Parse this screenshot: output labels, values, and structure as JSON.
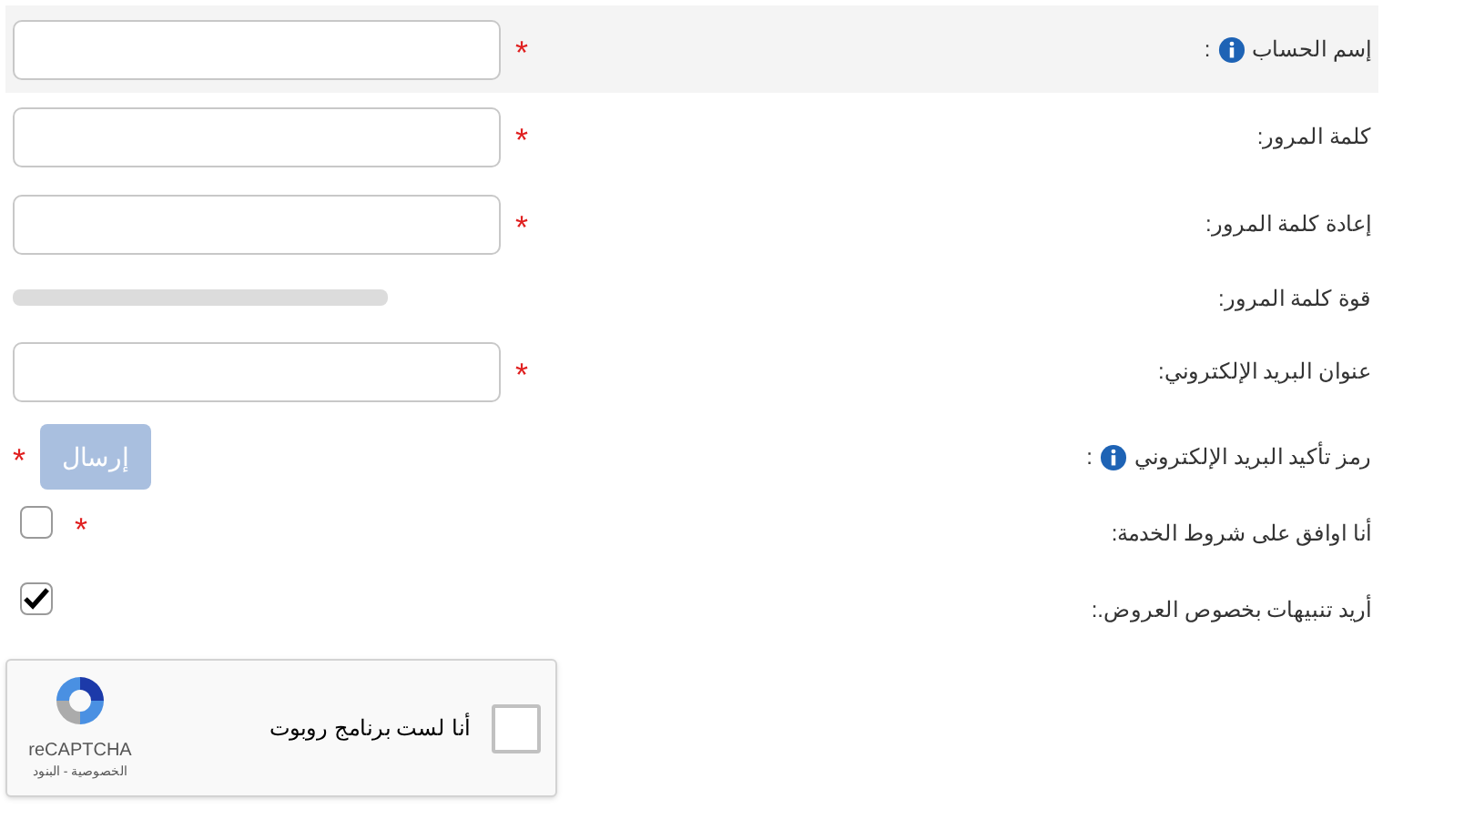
{
  "rows": [
    {
      "kind": "input",
      "label": "إسم الحساب",
      "info": true,
      "label_end": ":",
      "required": "*",
      "highlighted": true
    },
    {
      "kind": "input",
      "label": "كلمة المرور:",
      "required": "*"
    },
    {
      "kind": "input",
      "label": "إعادة كلمة المرور:",
      "required": "*"
    },
    {
      "kind": "meter",
      "label": "قوة كلمة المرور:",
      "level": 0
    },
    {
      "kind": "input",
      "label": "عنوان البريد الإلكتروني:",
      "required": "*"
    },
    {
      "kind": "button",
      "label": "رمز تأكيد البريد الإلكتروني",
      "info": true,
      "label_end": ":",
      "button": "إرسال",
      "disabled": true,
      "required": "*"
    },
    {
      "kind": "checkbox",
      "label": "أنا اوافق على شروط الخدمة:",
      "checked": false,
      "required": "*"
    },
    {
      "kind": "checkbox",
      "label": "أريد تنبيهات بخصوص العروض.:",
      "checked": true
    }
  ],
  "captcha": {
    "label": "أنا لست برنامج روبوت",
    "checked": false,
    "brand": "reCAPTCHA",
    "links": "الخصوصية - البنود"
  }
}
